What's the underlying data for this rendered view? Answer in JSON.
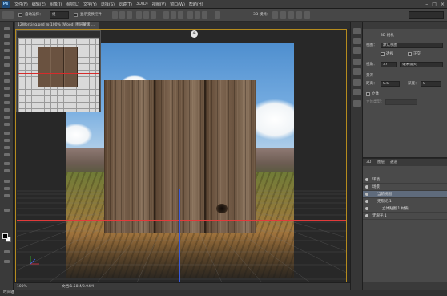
{
  "app": {
    "logo": "Ps"
  },
  "menubar": {
    "items": [
      "文件(F)",
      "编辑(E)",
      "图像(I)",
      "图层(L)",
      "文字(Y)",
      "选择(S)",
      "滤镜(T)",
      "3D(D)",
      "视图(V)",
      "窗口(W)",
      "帮助(H)"
    ]
  },
  "window_controls": {
    "minimize": "–",
    "maximize": "□",
    "close": "×"
  },
  "options_bar": {
    "auto_select_label": "自动选择：",
    "auto_select_value": "组",
    "show_transform_label": "显示变换控件",
    "mode_3d_label": "3D 模式："
  },
  "document": {
    "tab_title": "12Working.psd @ 100% (Wood, 图层蒙版 ...",
    "canvas_widget": "⊕"
  },
  "status": {
    "zoom": "100%",
    "doc_info": "文档:1.58M/8.94M"
  },
  "bottom": {
    "timeline_label": "时间轴"
  },
  "properties": {
    "header": "3D 相机",
    "view_label": "视图：",
    "view_value": "默认视图",
    "perspective_label": "透视",
    "ortho_label": "正交",
    "fov_label": "视角：",
    "fov_value": "37",
    "fov_unit": "毫米镜头",
    "dof_header": "景深",
    "distance_label": "距离：",
    "distance_value": "0.5",
    "depth_label": "深度：",
    "depth_value": "0",
    "stereo_label": "立体",
    "stereo_type_label": "立体类型："
  },
  "layers": {
    "tabs": [
      "3D",
      "图层",
      "通道"
    ],
    "rows": [
      {
        "name": "环境",
        "indent": 0
      },
      {
        "name": "场景",
        "indent": 0
      },
      {
        "name": "当前视图",
        "indent": 1,
        "selected": true
      },
      {
        "name": "无限光 1",
        "indent": 1
      },
      {
        "name": "立体贴图 1 材质",
        "indent": 1
      },
      {
        "name": "无限光 1",
        "indent": 0
      }
    ]
  }
}
